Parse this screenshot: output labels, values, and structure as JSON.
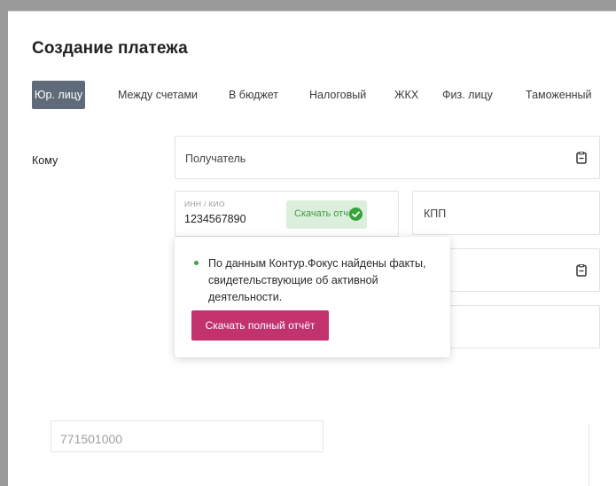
{
  "page": {
    "title": "Создание платежа"
  },
  "tabs": [
    {
      "label": "Юр. лицу",
      "active": true
    },
    {
      "label": "Между счетами",
      "active": false
    },
    {
      "label": "В бюджет",
      "active": false
    },
    {
      "label": "Налоговый",
      "active": false
    },
    {
      "label": "ЖКХ",
      "active": false
    },
    {
      "label": "Физ. лицу",
      "active": false
    },
    {
      "label": "Таможенный",
      "active": false
    }
  ],
  "form": {
    "komu_label": "Кому",
    "recipient_placeholder": "Получатель",
    "inn_label": "ИНН / КИО",
    "inn_value": "1234567890",
    "download_badge": "Скачать отчёт",
    "kpp_placeholder": "КПП",
    "bottom_value": "771501000"
  },
  "popup": {
    "text": "По данным Контур.Фокус найдены факты, свидетельствующие об активной деятельности.",
    "button": "Скачать полный отчёт"
  },
  "icons": {
    "recipient": "clipboard-icon",
    "second_field": "clipboard-icon",
    "badge": "check-circle-icon",
    "bullet": "bullet-dot-icon"
  },
  "colors": {
    "active_tab": "#5f6b78",
    "success": "#37a33b",
    "success_bg": "#dcefdc",
    "primary_button": "#c2336e"
  }
}
